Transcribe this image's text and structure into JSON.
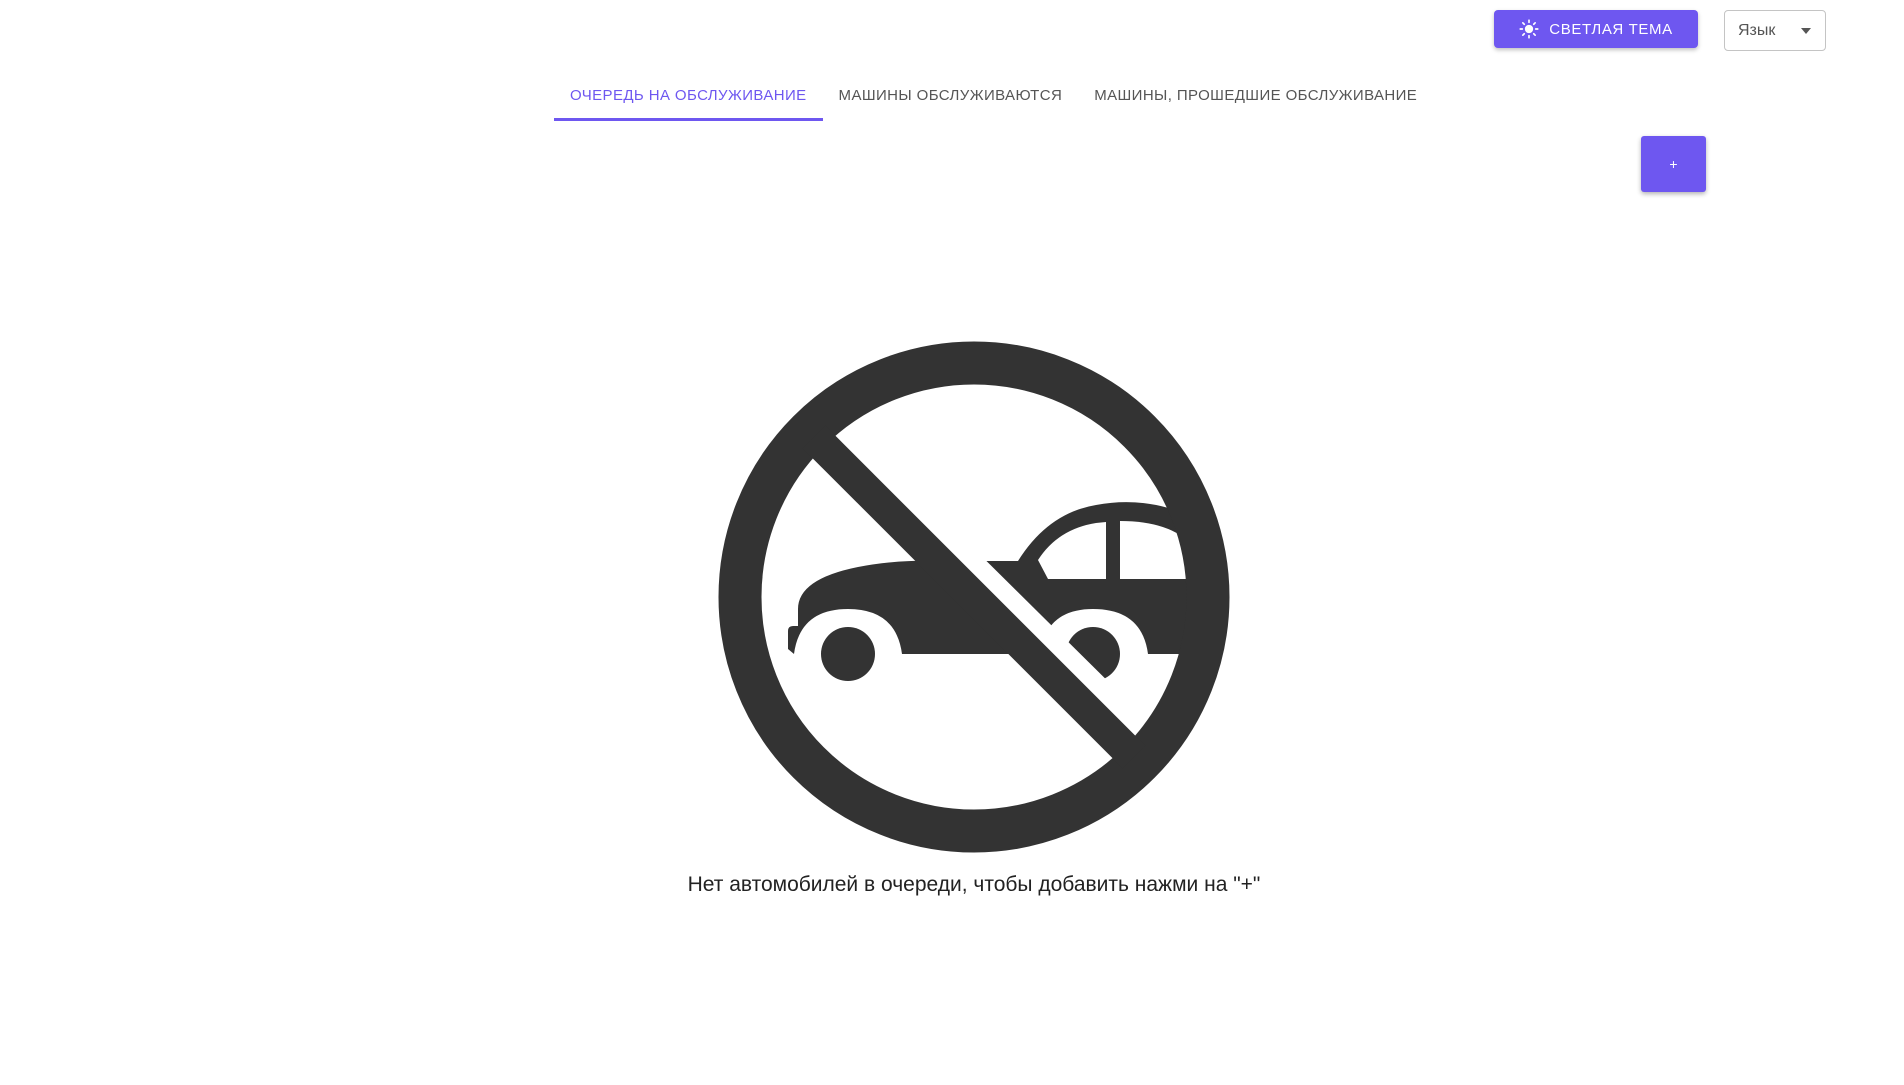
{
  "header": {
    "theme_button_label": "СВЕТЛАЯ ТЕМА",
    "theme_icon": "sun-icon",
    "language_label": "Язык"
  },
  "tabs": [
    {
      "label": "ОЧЕРЕДЬ НА ОБСЛУЖИВАНИЕ",
      "active": true
    },
    {
      "label": "МАШИНЫ ОБСЛУЖИВАЮТСЯ",
      "active": false
    },
    {
      "label": "МАШИНЫ, ПРОШЕДШИЕ ОБСЛУЖИВАНИЕ",
      "active": false
    }
  ],
  "actions": {
    "add_label": "+"
  },
  "empty_state": {
    "icon": "no-car-icon",
    "message": "Нет автомобилей в очереди, чтобы добавить нажми на \"+\""
  },
  "colors": {
    "accent": "#6e57f0",
    "icon_dark": "#333333"
  }
}
